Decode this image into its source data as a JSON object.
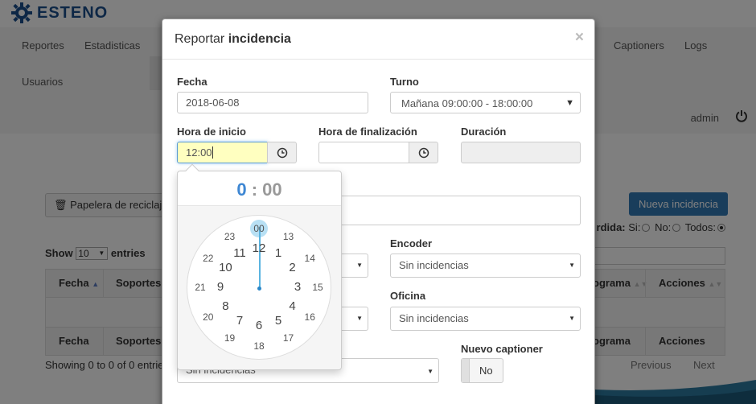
{
  "app": {
    "logo_text": "ESTENO",
    "nav": [
      "Reportes",
      "Estadisticas",
      "Captioners",
      "Logs",
      "Usuarios"
    ],
    "user": "admin",
    "trash_button": "Papelera de reciclaje",
    "new_button": "Nueva incidencia",
    "filter": {
      "label": "rdida:",
      "si": "Si:",
      "no": "No:",
      "todos": "Todos:"
    },
    "show": {
      "prefix": "Show",
      "value": "10",
      "suffix": "entries"
    },
    "table": {
      "headers_left": [
        "Fecha",
        "Soportes"
      ],
      "headers_right": [
        "ograma",
        "Acciones"
      ]
    },
    "showing": "Showing 0 to 0 of 0 entries",
    "pager": {
      "previous": "Previous",
      "next": "Next"
    }
  },
  "modal": {
    "title_prefix": "Reportar",
    "title_bold": "incidencia",
    "close": "×",
    "fecha": {
      "label": "Fecha",
      "value": "2018-06-08"
    },
    "turno": {
      "label": "Turno",
      "value": "Mañana 09:00:00 - 18:00:00"
    },
    "hora_inicio": {
      "label": "Hora de inicio",
      "value": "12:00"
    },
    "hora_fin": {
      "label": "Hora de finalización",
      "value": ""
    },
    "duracion": {
      "label": "Duración",
      "value": ""
    },
    "encoder": {
      "label": "Encoder",
      "value": "Sin incidencias"
    },
    "oficina": {
      "label": "Oficina",
      "value": "Sin incidencias"
    },
    "bottom_select": {
      "value": "Sin incidencias"
    },
    "nuevo_captioner": {
      "label": "Nuevo captioner",
      "value": "No"
    }
  },
  "clockpicker": {
    "hour": "0",
    "separator": ":",
    "minute": "00",
    "outer": [
      "12",
      "1",
      "2",
      "3",
      "4",
      "5",
      "6",
      "7",
      "8",
      "9",
      "10",
      "11"
    ],
    "inner": [
      "00",
      "13",
      "14",
      "15",
      "16",
      "17",
      "18",
      "19",
      "20",
      "21",
      "22",
      "23"
    ],
    "selected": "00"
  },
  "colors": {
    "accent": "#337ab7",
    "clock_hand": "#5ab4e0",
    "highlight_input": "#ffffc0"
  }
}
